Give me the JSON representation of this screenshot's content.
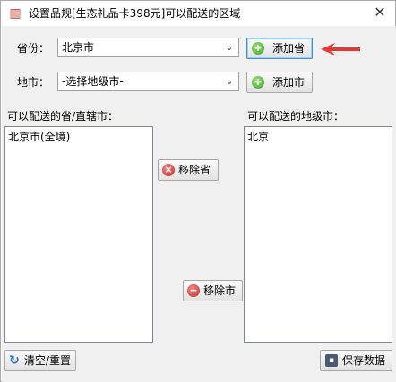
{
  "window": {
    "title": "设置品规[生态礼品卡398元]可以配送的区域",
    "close_symbol": "✕"
  },
  "province": {
    "label": "省份：",
    "selected": "北京市",
    "add_button": "添加省"
  },
  "city": {
    "label": "地市：",
    "selected": "-选择地级市-",
    "add_button": "添加市"
  },
  "left_list": {
    "label": "可以配送的省/直辖市：",
    "items": [
      "北京市(全境)"
    ]
  },
  "right_list": {
    "label": "可以配送的地级市：",
    "items": [
      "北京"
    ]
  },
  "buttons": {
    "remove_province": "移除省",
    "remove_city": "移除市",
    "clear_reset": "清空/重置",
    "save": "保存数据"
  },
  "icons": {
    "app": "app-icon",
    "add": "plus-circle-icon",
    "remove_province": "x-circle-icon",
    "remove_city": "minus-circle-icon",
    "refresh": "refresh-icon",
    "save": "save-disk-icon"
  },
  "colors": {
    "accent_focus": "#3c8fd6",
    "annotation_arrow": "#e53935"
  }
}
